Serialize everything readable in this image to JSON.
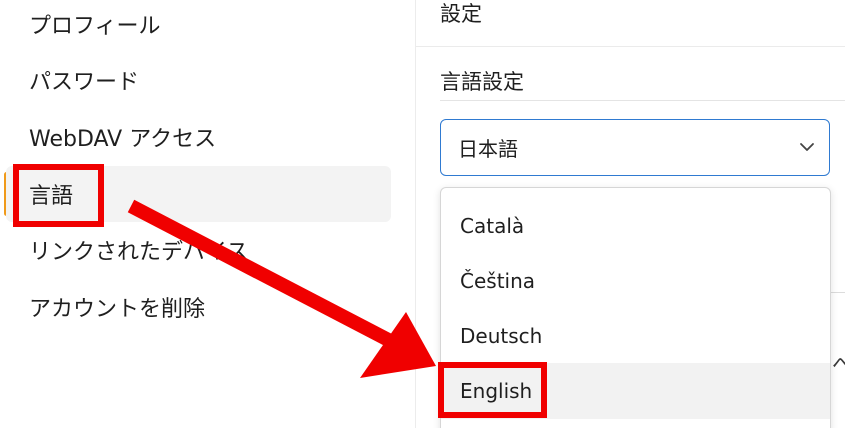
{
  "sidebar": {
    "items": [
      {
        "label": "プロフィール"
      },
      {
        "label": "パスワード"
      },
      {
        "label": "WebDAV アクセス"
      },
      {
        "label": "言語"
      },
      {
        "label": "リンクされたデバイス"
      },
      {
        "label": "アカウントを削除"
      }
    ],
    "active_index": 3
  },
  "main": {
    "title": "設定",
    "section_label": "言語設定",
    "language_select": {
      "value": "日本語",
      "options": [
        "Català",
        "Čeština",
        "Deutsch",
        "English"
      ],
      "hovered": "English"
    },
    "background_partial_text": "へ"
  },
  "colors": {
    "accent": "#f09a1a",
    "focus_border": "#2f7ad1",
    "annotation": "#f00000"
  }
}
